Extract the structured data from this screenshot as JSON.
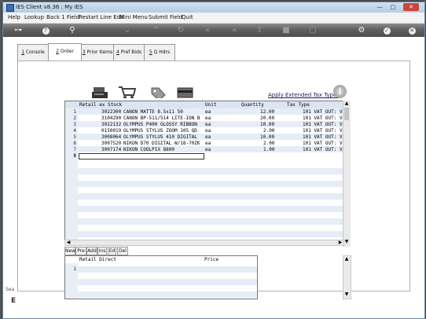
{
  "window": {
    "title": "IES Client v8.36 : My IES"
  },
  "menu": [
    "Help",
    "Lookup",
    "Back 1 Field",
    "Restart Line Edit",
    "Mini Menu",
    "Submit Field",
    "Quit"
  ],
  "tabs": [
    {
      "key": "1",
      "label": "Console"
    },
    {
      "key": "2",
      "label": "Order Items"
    },
    {
      "key": "3",
      "label": "Prior Items"
    },
    {
      "key": "4",
      "label": "Pref Bids"
    },
    {
      "key": "5",
      "label": "Q Hdrs"
    }
  ],
  "link": "Apply Extended Tax Types",
  "grid": {
    "headers": [
      "Retail ex Stock",
      "Unit",
      "Quantity",
      "Tax Type"
    ],
    "rows": [
      {
        "n": "1",
        "code": "3022300",
        "desc": "CANON MATTE 8.5x11 50",
        "unit": "ea",
        "qty": "12.00",
        "tax": "101 VAT OUT: V"
      },
      {
        "n": "2",
        "code": "3104290",
        "desc": "CANON BP-511/514 LITE-ION B",
        "unit": "ea",
        "qty": "20.00",
        "tax": "101 VAT OUT: V"
      },
      {
        "n": "3",
        "code": "3022132",
        "desc": "OLYMPUS P400 GLOSSY RIBBON",
        "unit": "ea",
        "qty": "10.00",
        "tax": "101 VAT OUT: V"
      },
      {
        "n": "4",
        "code": "0150019",
        "desc": "OLYMPUS STYLUS ZOOM 105 QD",
        "unit": "ea",
        "qty": "2.00",
        "tax": "101 VAT OUT: V"
      },
      {
        "n": "5",
        "code": "3008064",
        "desc": "OLYMPUS STYLUS 410 DIGITAL",
        "unit": "ea",
        "qty": "10.00",
        "tax": "101 VAT OUT: V"
      },
      {
        "n": "6",
        "code": "3007520",
        "desc": "NIKON D70 DIGITAL W/18-70ZK",
        "unit": "ea",
        "qty": "2.00",
        "tax": "101 VAT OUT: V"
      },
      {
        "n": "7",
        "code": "3007174",
        "desc": "NIKON COOLPIX 8800",
        "unit": "ea",
        "qty": "1.00",
        "tax": "101 VAT OUT: V"
      }
    ],
    "new_row": "8"
  },
  "nav": [
    "New",
    "Pre",
    "Add",
    "Ins",
    "Ed",
    "Del"
  ],
  "grid2": {
    "headers": [
      "Retail Direct",
      "Price"
    ],
    "row": "1"
  },
  "side": {
    "label": "Sea",
    "letter": "E"
  }
}
